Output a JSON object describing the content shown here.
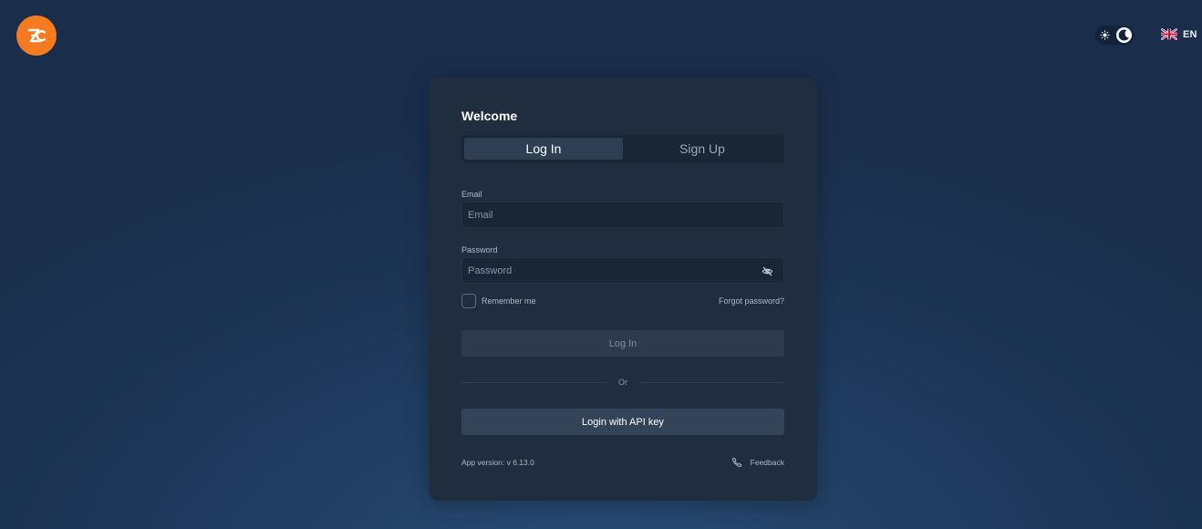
{
  "brand": {
    "logo_icon": "zc-logo-icon",
    "color": "#f47b20"
  },
  "header": {
    "theme_toggle": {
      "state": "dark",
      "icons": [
        "sun-icon",
        "moon-icon"
      ]
    },
    "language": {
      "code": "EN",
      "flag_icon": "uk-flag-icon"
    }
  },
  "card": {
    "title": "Welcome",
    "tabs": [
      {
        "label": "Log In",
        "active": true
      },
      {
        "label": "Sign Up",
        "active": false
      }
    ],
    "email": {
      "label": "Email",
      "placeholder": "Email",
      "value": ""
    },
    "password": {
      "label": "Password",
      "placeholder": "Password",
      "value": "",
      "toggle_icon": "eye-off-icon"
    },
    "remember_label": "Remember me",
    "remember_checked": false,
    "forgot_label": "Forgot password?",
    "login_button": "Log In",
    "divider_label": "Or",
    "api_button": "Login with API key",
    "version": "App version: v 6.13.0",
    "feedback_label": "Feedback",
    "feedback_icon": "phone-icon"
  },
  "colors": {
    "card_bg": "#1f2d3e",
    "input_bg": "#1a2535",
    "active_tab": "#2e3f54",
    "api_button": "#334458"
  }
}
